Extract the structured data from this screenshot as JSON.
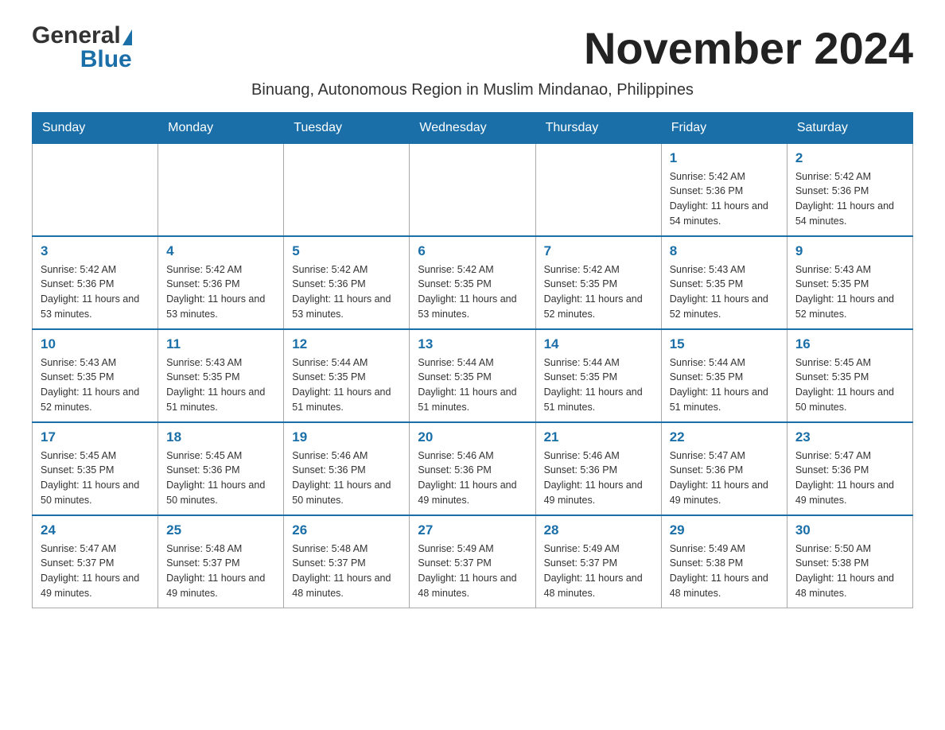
{
  "header": {
    "month_title": "November 2024",
    "subtitle": "Binuang, Autonomous Region in Muslim Mindanao, Philippines",
    "logo_general": "General",
    "logo_blue": "Blue"
  },
  "days_of_week": [
    "Sunday",
    "Monday",
    "Tuesday",
    "Wednesday",
    "Thursday",
    "Friday",
    "Saturday"
  ],
  "weeks": [
    [
      {
        "day": "",
        "info": ""
      },
      {
        "day": "",
        "info": ""
      },
      {
        "day": "",
        "info": ""
      },
      {
        "day": "",
        "info": ""
      },
      {
        "day": "",
        "info": ""
      },
      {
        "day": "1",
        "info": "Sunrise: 5:42 AM\nSunset: 5:36 PM\nDaylight: 11 hours and 54 minutes."
      },
      {
        "day": "2",
        "info": "Sunrise: 5:42 AM\nSunset: 5:36 PM\nDaylight: 11 hours and 54 minutes."
      }
    ],
    [
      {
        "day": "3",
        "info": "Sunrise: 5:42 AM\nSunset: 5:36 PM\nDaylight: 11 hours and 53 minutes."
      },
      {
        "day": "4",
        "info": "Sunrise: 5:42 AM\nSunset: 5:36 PM\nDaylight: 11 hours and 53 minutes."
      },
      {
        "day": "5",
        "info": "Sunrise: 5:42 AM\nSunset: 5:36 PM\nDaylight: 11 hours and 53 minutes."
      },
      {
        "day": "6",
        "info": "Sunrise: 5:42 AM\nSunset: 5:35 PM\nDaylight: 11 hours and 53 minutes."
      },
      {
        "day": "7",
        "info": "Sunrise: 5:42 AM\nSunset: 5:35 PM\nDaylight: 11 hours and 52 minutes."
      },
      {
        "day": "8",
        "info": "Sunrise: 5:43 AM\nSunset: 5:35 PM\nDaylight: 11 hours and 52 minutes."
      },
      {
        "day": "9",
        "info": "Sunrise: 5:43 AM\nSunset: 5:35 PM\nDaylight: 11 hours and 52 minutes."
      }
    ],
    [
      {
        "day": "10",
        "info": "Sunrise: 5:43 AM\nSunset: 5:35 PM\nDaylight: 11 hours and 52 minutes."
      },
      {
        "day": "11",
        "info": "Sunrise: 5:43 AM\nSunset: 5:35 PM\nDaylight: 11 hours and 51 minutes."
      },
      {
        "day": "12",
        "info": "Sunrise: 5:44 AM\nSunset: 5:35 PM\nDaylight: 11 hours and 51 minutes."
      },
      {
        "day": "13",
        "info": "Sunrise: 5:44 AM\nSunset: 5:35 PM\nDaylight: 11 hours and 51 minutes."
      },
      {
        "day": "14",
        "info": "Sunrise: 5:44 AM\nSunset: 5:35 PM\nDaylight: 11 hours and 51 minutes."
      },
      {
        "day": "15",
        "info": "Sunrise: 5:44 AM\nSunset: 5:35 PM\nDaylight: 11 hours and 51 minutes."
      },
      {
        "day": "16",
        "info": "Sunrise: 5:45 AM\nSunset: 5:35 PM\nDaylight: 11 hours and 50 minutes."
      }
    ],
    [
      {
        "day": "17",
        "info": "Sunrise: 5:45 AM\nSunset: 5:35 PM\nDaylight: 11 hours and 50 minutes."
      },
      {
        "day": "18",
        "info": "Sunrise: 5:45 AM\nSunset: 5:36 PM\nDaylight: 11 hours and 50 minutes."
      },
      {
        "day": "19",
        "info": "Sunrise: 5:46 AM\nSunset: 5:36 PM\nDaylight: 11 hours and 50 minutes."
      },
      {
        "day": "20",
        "info": "Sunrise: 5:46 AM\nSunset: 5:36 PM\nDaylight: 11 hours and 49 minutes."
      },
      {
        "day": "21",
        "info": "Sunrise: 5:46 AM\nSunset: 5:36 PM\nDaylight: 11 hours and 49 minutes."
      },
      {
        "day": "22",
        "info": "Sunrise: 5:47 AM\nSunset: 5:36 PM\nDaylight: 11 hours and 49 minutes."
      },
      {
        "day": "23",
        "info": "Sunrise: 5:47 AM\nSunset: 5:36 PM\nDaylight: 11 hours and 49 minutes."
      }
    ],
    [
      {
        "day": "24",
        "info": "Sunrise: 5:47 AM\nSunset: 5:37 PM\nDaylight: 11 hours and 49 minutes."
      },
      {
        "day": "25",
        "info": "Sunrise: 5:48 AM\nSunset: 5:37 PM\nDaylight: 11 hours and 49 minutes."
      },
      {
        "day": "26",
        "info": "Sunrise: 5:48 AM\nSunset: 5:37 PM\nDaylight: 11 hours and 48 minutes."
      },
      {
        "day": "27",
        "info": "Sunrise: 5:49 AM\nSunset: 5:37 PM\nDaylight: 11 hours and 48 minutes."
      },
      {
        "day": "28",
        "info": "Sunrise: 5:49 AM\nSunset: 5:37 PM\nDaylight: 11 hours and 48 minutes."
      },
      {
        "day": "29",
        "info": "Sunrise: 5:49 AM\nSunset: 5:38 PM\nDaylight: 11 hours and 48 minutes."
      },
      {
        "day": "30",
        "info": "Sunrise: 5:50 AM\nSunset: 5:38 PM\nDaylight: 11 hours and 48 minutes."
      }
    ]
  ]
}
